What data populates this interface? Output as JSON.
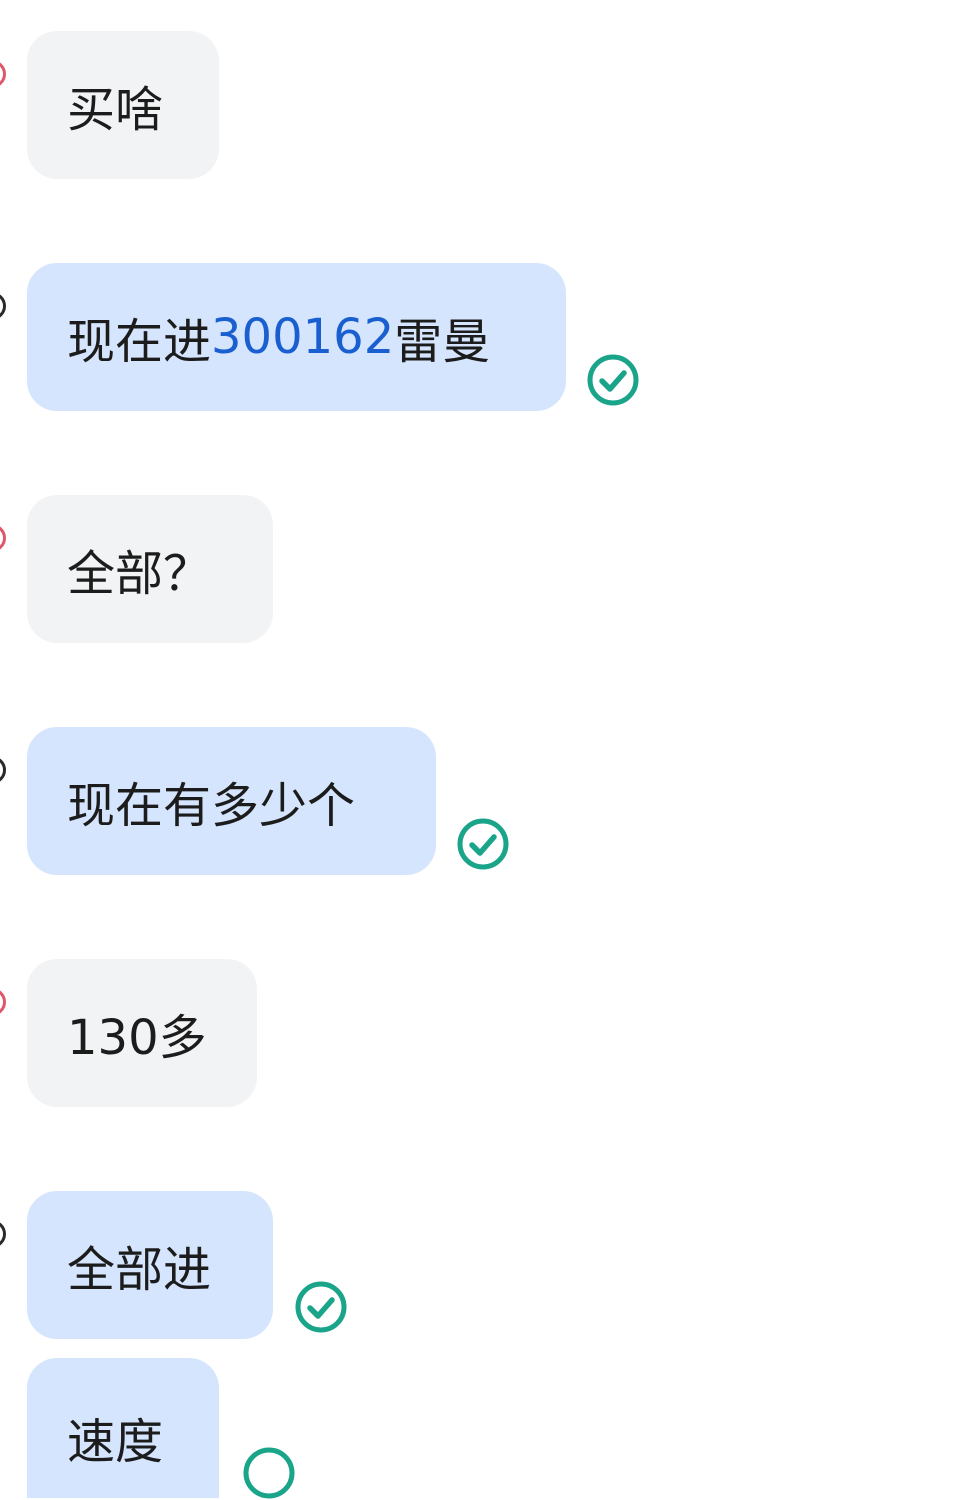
{
  "colors": {
    "incoming_bubble": "#f2f3f5",
    "outgoing_bubble": "#d5e5fd",
    "link": "#1a5fd0",
    "read_check": "#1aa58a",
    "text": "#1c1c1c"
  },
  "messages": [
    {
      "direction": "incoming",
      "text": "买啥"
    },
    {
      "direction": "outgoing",
      "text_before": "现在进",
      "link": "300162",
      "text_after": "雷曼",
      "status_icon": "read-check-icon"
    },
    {
      "direction": "incoming",
      "text": "全部？"
    },
    {
      "direction": "outgoing",
      "text": "现在有多少个",
      "status_icon": "read-check-icon"
    },
    {
      "direction": "incoming",
      "text": "130多"
    },
    {
      "direction": "outgoing",
      "text": "全部进",
      "status_icon": "read-check-icon"
    },
    {
      "direction": "outgoing",
      "text": "速度",
      "status_icon": "read-check-icon"
    }
  ]
}
